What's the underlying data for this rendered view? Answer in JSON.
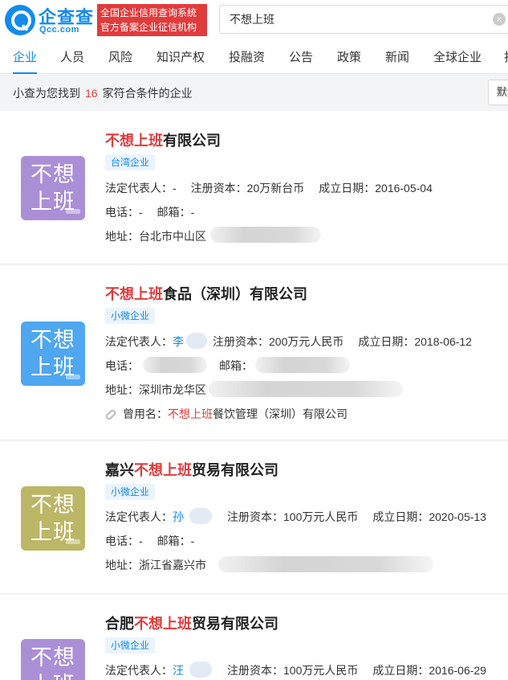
{
  "header": {
    "logo_name": "企查查",
    "logo_domain": "Qcc.com",
    "slogan_line1": "全国企业信用查询系统",
    "slogan_line2": "官方备案企业征信机构",
    "search_value": "不想上班",
    "brand_color": "#128bed",
    "accent_color": "#e23b3b"
  },
  "tabs": [
    "企业",
    "人员",
    "风险",
    "知识产权",
    "投融资",
    "公告",
    "政策",
    "新闻",
    "全球企业",
    "找"
  ],
  "results": {
    "prefix": "小查为您找到",
    "count": "16",
    "suffix": "家符合条件的企业",
    "sort_label": "默认"
  },
  "labels": {
    "legal_rep": "法定代表人：",
    "capital": "注册资本：",
    "founded": "成立日期：",
    "phone": "电话：",
    "email": "邮箱：",
    "address": "地址：",
    "former_name": "曾用名："
  },
  "companies": [
    {
      "avatar_text": "不想上班",
      "avatar_color": "#ab8fd6",
      "name_prefix": "",
      "name_highlight": "不想上班",
      "name_suffix": "有限公司",
      "tag": "台湾企业",
      "legal_rep": "-",
      "capital": "20万新台币",
      "founded": "2016-05-04",
      "phone": "-",
      "email": "-",
      "address": "台北市中山区"
    },
    {
      "avatar_text": "不想上班",
      "avatar_color": "#4fa7ef",
      "name_prefix": "",
      "name_highlight": "不想上班",
      "name_suffix": "食品（深圳）有限公司",
      "tag": "小微企业",
      "legal_rep": "李",
      "capital": "200万元人民币",
      "founded": "2018-06-12",
      "address": "深圳市龙华区",
      "former_highlight": "不想上班",
      "former_suffix": "餐饮管理（深圳）有限公司"
    },
    {
      "avatar_text": "不想上班",
      "avatar_color": "#bcb667",
      "name_prefix": "嘉兴",
      "name_highlight": "不想上班",
      "name_suffix": "贸易有限公司",
      "tag": "小微企业",
      "legal_rep": "孙",
      "capital": "100万元人民币",
      "founded": "2020-05-13",
      "phone": "-",
      "email": "-",
      "address": "浙江省嘉兴市"
    },
    {
      "avatar_text": "不想上班",
      "avatar_color": "#ab8fd6",
      "name_prefix": "合肥",
      "name_highlight": "不想上班",
      "name_suffix": "贸易有限公司",
      "tag": "小微企业",
      "legal_rep": "汪",
      "capital": "100万元人民币",
      "founded": "2016-06-29"
    }
  ]
}
